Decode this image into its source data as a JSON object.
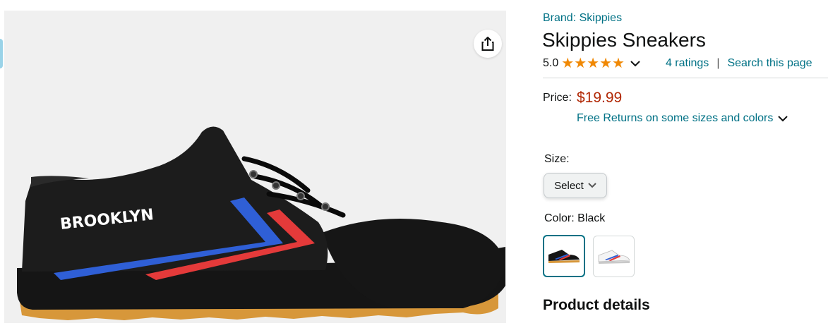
{
  "product": {
    "brand_link": "Brand: Skippies",
    "title": "Skippies Sneakers",
    "rating_value": "5.0",
    "rating_stars": 5,
    "ratings_link": "4 ratings",
    "separator": "|",
    "search_link": "Search this page",
    "price_label": "Price:",
    "price": "$19.99",
    "returns_text": "Free Returns on some sizes and colors",
    "size_label": "Size:",
    "size_value": "Select",
    "color_label": "Color:",
    "color_value": "Black",
    "shoe_text": "BROOKLYN",
    "details_heading": "Product details"
  },
  "colors": {
    "link": "#007185",
    "price": "#B12704",
    "star": "#F08804"
  },
  "icons": [
    "share-icon",
    "star-icon",
    "chevron-down-icon"
  ]
}
